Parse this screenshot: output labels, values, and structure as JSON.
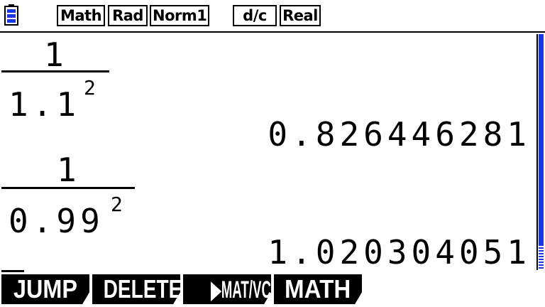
{
  "status_bar": {
    "battery_icon": "battery-icon",
    "badges": [
      "Math",
      "Rad",
      "Norm1",
      "d/c",
      "Real"
    ]
  },
  "history": [
    {
      "numerator": "1",
      "denominator_base": "1.1",
      "denominator_exponent": "2",
      "result": "0.826446281"
    },
    {
      "numerator": "1",
      "denominator_base": "0.99",
      "denominator_exponent": "2",
      "result": "1.020304051"
    }
  ],
  "function_keys": [
    "JUMP",
    "DELETE",
    "▶MAT/VCT",
    "MATH"
  ],
  "colors": {
    "accent": "#1a37e0",
    "background": "#ffffff",
    "text": "#000000"
  }
}
